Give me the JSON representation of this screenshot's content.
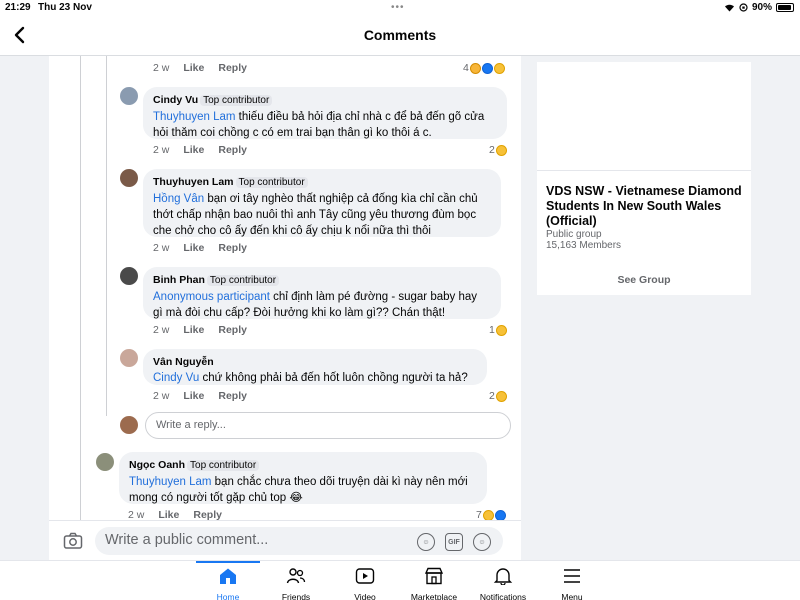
{
  "status_bar": {
    "time": "21:29",
    "date": "Thu 23 Nov",
    "dots": "•••",
    "battery": "90%"
  },
  "header": {
    "title": "Comments"
  },
  "comments": [
    {
      "time": "2 w",
      "like": "Like",
      "reply": "Reply",
      "reactions": "4"
    },
    {
      "author": "Cindy Vu",
      "badge": "Top contributor",
      "mention": "Thuyhuyen Lam",
      "text_1": " thiếu điều bả hỏi địa chỉ nhà c để bả đến gõ cửa",
      "text_2": "hỏi thăm coi chồng c có em trai bạn thân gì ko thôi á c.",
      "time": "2 w",
      "like": "Like",
      "reply": "Reply",
      "reactions": "2"
    },
    {
      "author": "Thuyhuyen Lam",
      "badge": "Top contributor",
      "mention": "Hồng Vân",
      "text_1": " bạn ơi tây nghèo thất nghiệp cả đống kìa chỉ cần chủ",
      "text_2": "thớt chấp nhận  bao nuôi thì anh Tây cũng yêu thương đùm bọc",
      "text_3": "che chở  cho cô ấy đến khi cô ấy chịu k nổi nữa thì thôi",
      "time": "2 w",
      "like": "Like",
      "reply": "Reply"
    },
    {
      "author": "Binh Phan",
      "badge": "Top contributor",
      "mention": "Anonymous participant",
      "text_1": " chỉ định làm pé đường - sugar baby hay",
      "text_2": "gì mà đòi chu cấp? Đòi hưởng khi ko làm gì?? Chán thật!",
      "time": "2 w",
      "like": "Like",
      "reply": "Reply",
      "reactions": "1"
    },
    {
      "author": "Vân Nguyễn",
      "mention": "Cindy Vu",
      "text_1": " chứ không phải bả đến hốt luôn chồng người ta hả?",
      "time": "2 w",
      "like": "Like",
      "reply": "Reply",
      "reactions": "2"
    },
    {
      "author": "Ngọc Oanh",
      "badge": "Top contributor",
      "mention": "Thuyhuyen Lam",
      "text_1": " bạn chắc chưa theo dõi truyện dài kì này nên mới",
      "text_2": "mong có người tốt gặp chủ top 😂",
      "time": "2 w",
      "like": "Like",
      "reply": "Reply",
      "reactions": "7"
    }
  ],
  "reply_box": {
    "placeholder": "Write a reply..."
  },
  "composer": {
    "placeholder": "Write a public comment...",
    "gif": "GIF"
  },
  "group": {
    "name": "VDS NSW - Vietnamese Diamond Students In New South Wales (Official)",
    "type": "Public group",
    "members": "15,163 Members",
    "button": "See Group"
  },
  "tabs": [
    {
      "label": "Home",
      "icon": "home-icon"
    },
    {
      "label": "Friends",
      "icon": "friends-icon"
    },
    {
      "label": "Video",
      "icon": "video-icon"
    },
    {
      "label": "Marketplace",
      "icon": "marketplace-icon"
    },
    {
      "label": "Notifications",
      "icon": "bell-icon"
    },
    {
      "label": "Menu",
      "icon": "menu-icon"
    }
  ],
  "colors": {
    "accent": "#1877f2",
    "mention": "#216fdb",
    "bubble": "#f0f2f5",
    "page_bg": "#f0f2f5"
  }
}
